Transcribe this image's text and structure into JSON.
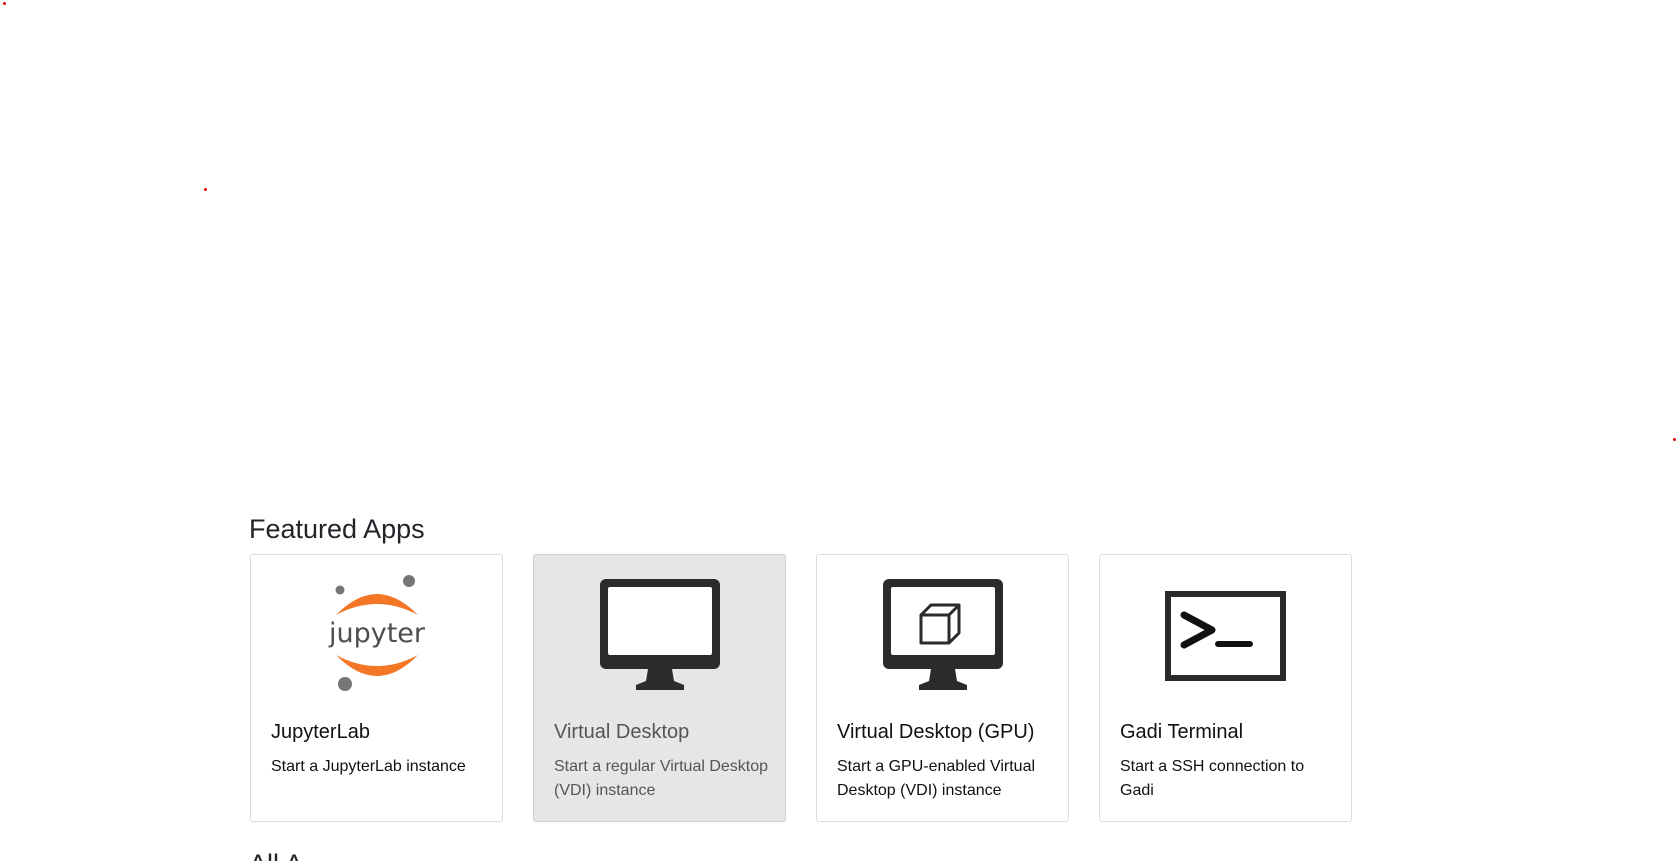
{
  "featured": {
    "title": "Featured Apps",
    "apps": [
      {
        "name": "JupyterLab",
        "description": "Start a JupyterLab instance",
        "icon": "jupyter-logo-icon"
      },
      {
        "name": "Virtual Desktop",
        "description": "Start a regular Virtual Desktop (VDI) instance",
        "icon": "monitor-icon"
      },
      {
        "name": "Virtual Desktop (GPU)",
        "description": "Start a GPU-enabled Virtual Desktop (VDI) instance",
        "icon": "monitor-cube-icon"
      },
      {
        "name": "Gadi Terminal",
        "description": "Start a SSH connection to Gadi",
        "icon": "terminal-icon"
      }
    ]
  },
  "all_apps": {
    "title": "All A"
  },
  "colors": {
    "jupyter_orange": "#F37726",
    "jupyter_grey": "#767677",
    "icon_dark": "#2b2b2b",
    "hover_card_bg": "#e6e6e6"
  }
}
